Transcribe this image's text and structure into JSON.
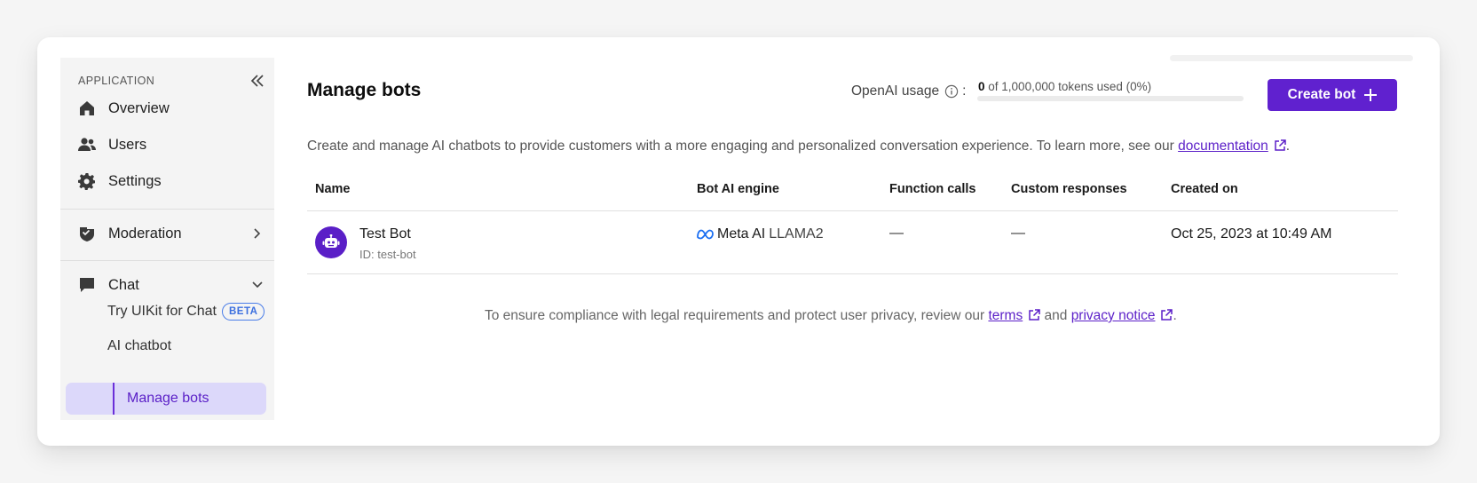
{
  "sidebar": {
    "section_label": "APPLICATION",
    "items": [
      {
        "label": "Overview",
        "icon": "home-icon"
      },
      {
        "label": "Users",
        "icon": "users-icon"
      },
      {
        "label": "Settings",
        "icon": "gear-icon"
      },
      {
        "label": "Moderation",
        "icon": "moderation-icon"
      },
      {
        "label": "Chat",
        "icon": "chat-icon"
      }
    ],
    "chat_sub": {
      "try_uikit": "Try UIKit for Chat",
      "beta_badge": "BETA",
      "ai_chatbot": "AI chatbot",
      "manage_bots": "Manage bots"
    }
  },
  "header": {
    "title": "Manage bots",
    "usage_label": "OpenAI usage",
    "usage_sep": ":",
    "usage_count": "0",
    "usage_rest": "of 1,000,000 tokens used (0%)",
    "usage_fraction": 0,
    "create_button": "Create bot"
  },
  "description": {
    "text": "Create and manage AI chatbots to provide customers with a more engaging and personalized conversation experience. To learn more, see our ",
    "link": "documentation",
    "end": "."
  },
  "table": {
    "columns": [
      "Name",
      "Bot AI engine",
      "Function calls",
      "Custom responses",
      "Created on"
    ],
    "rows": [
      {
        "name": "Test Bot",
        "id": "ID: test-bot",
        "engine_vendor": "Meta AI",
        "engine_model": "LLAMA2",
        "function_calls": "—",
        "custom_responses": "—",
        "created_on": "Oct 25, 2023 at 10:49 AM"
      }
    ]
  },
  "compliance": {
    "pre": "To ensure compliance with legal requirements and protect user privacy, review our ",
    "terms": "terms",
    "mid": " and ",
    "privacy": "privacy notice",
    "end": "."
  },
  "colors": {
    "accent": "#6021cf",
    "active_bg": "#dcd8fa",
    "beta": "#3b6fdf"
  }
}
